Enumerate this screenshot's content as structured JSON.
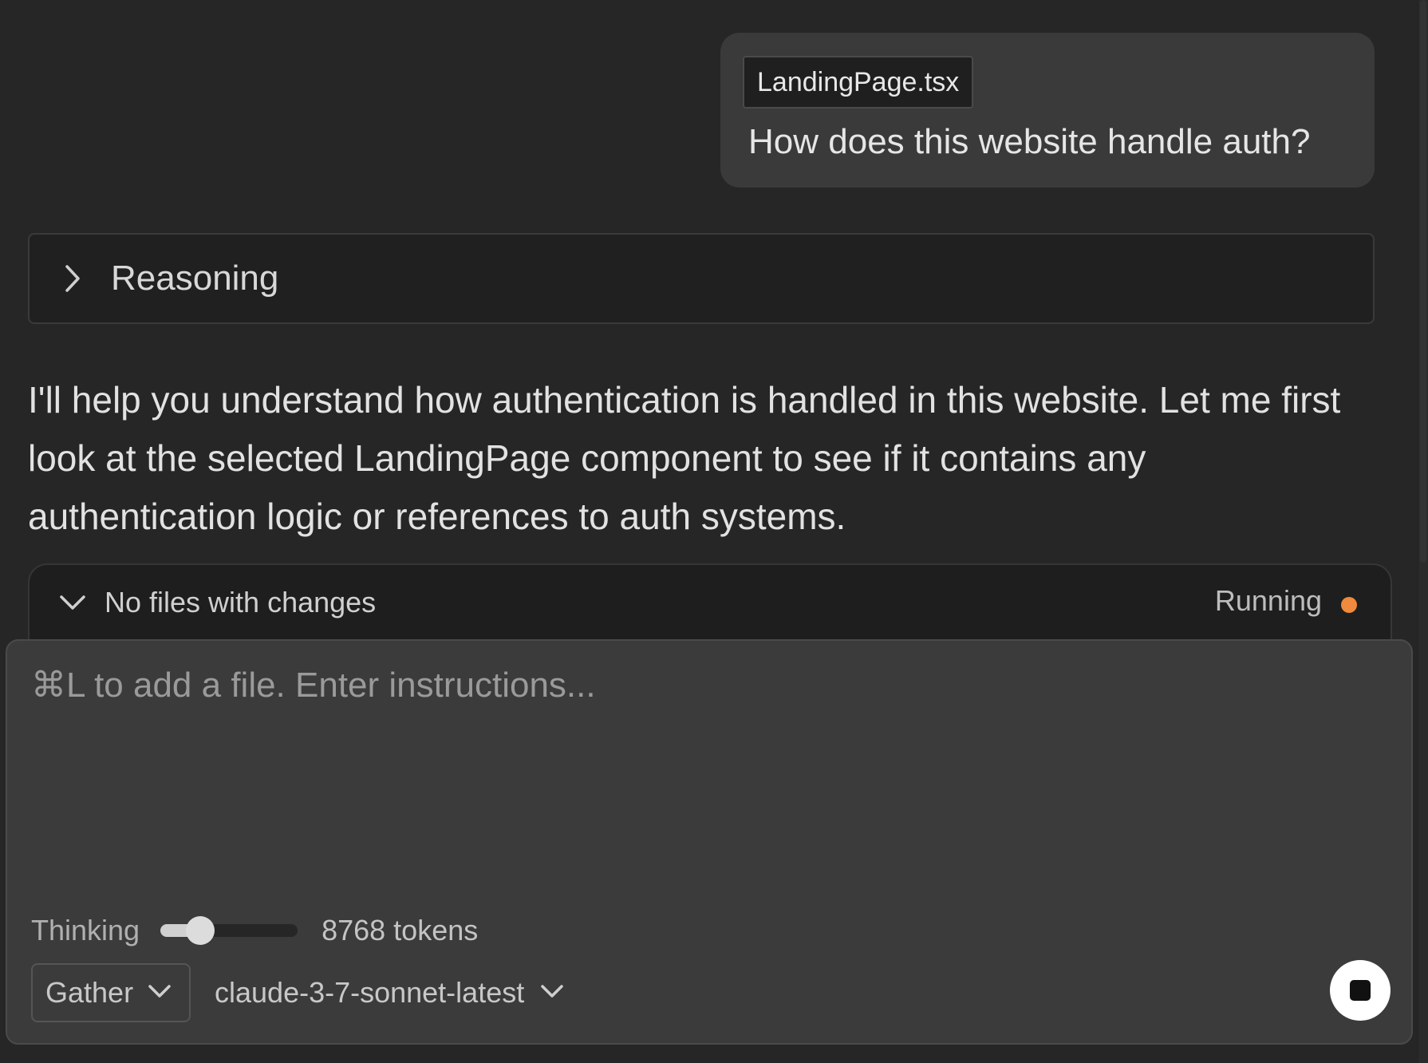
{
  "user_message": {
    "file_chip": "LandingPage.tsx",
    "text": "How does this website handle auth?"
  },
  "reasoning": {
    "label": "Reasoning",
    "icon": "chevron-right-icon"
  },
  "assistant": {
    "text": "I'll help you understand how authentication is handled in this website. Let me first look at the selected LandingPage component to see if it contains any authentication logic or references to auth systems."
  },
  "changes_panel": {
    "title": "No files with changes",
    "status": "Running",
    "status_color": "#f08a3c",
    "icon": "chevron-down-icon"
  },
  "composer": {
    "placeholder": "⌘L to add a file. Enter instructions...",
    "thinking_label": "Thinking",
    "thinking_level": 0.29,
    "tokens": "8768 tokens",
    "mode": "Gather",
    "model": "claude-3-7-sonnet-latest",
    "stop_icon": "stop-icon"
  }
}
